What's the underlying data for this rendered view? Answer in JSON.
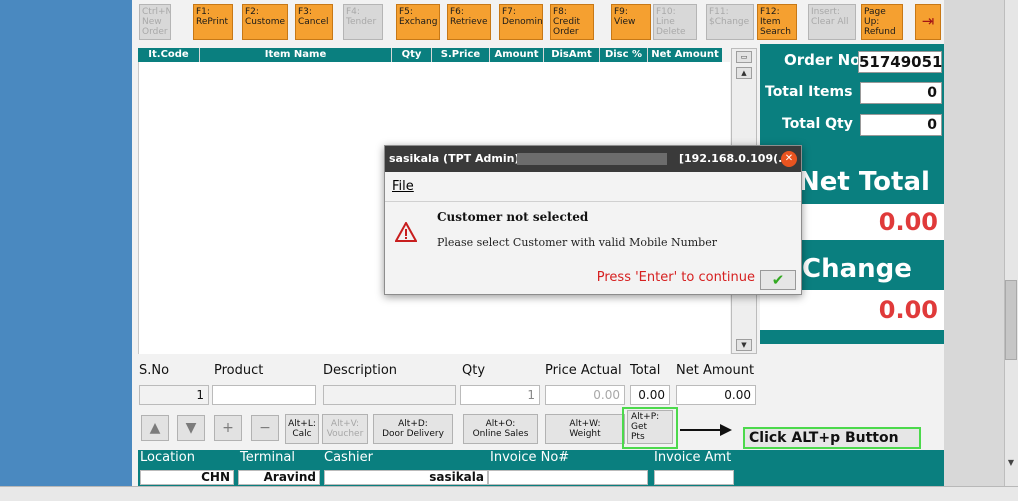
{
  "toolbar": {
    "keys": [
      {
        "l1": "Ctrl+N:",
        "l2": "New",
        "l3": "Order",
        "enabled": false
      },
      {
        "l1": "F1:",
        "l2": "RePrint",
        "l3": "",
        "enabled": true
      },
      {
        "l1": "F2:",
        "l2": "Custome",
        "l3": "",
        "enabled": true
      },
      {
        "l1": "F3:",
        "l2": "Cancel",
        "l3": "",
        "enabled": true
      },
      {
        "l1": "F4:",
        "l2": "Tender",
        "l3": "",
        "enabled": false
      },
      {
        "l1": "F5:",
        "l2": "Exchang",
        "l3": "",
        "enabled": true
      },
      {
        "l1": "F6:",
        "l2": "Retrieve",
        "l3": "",
        "enabled": true
      },
      {
        "l1": "F7:",
        "l2": "Denomin",
        "l3": "",
        "enabled": true
      },
      {
        "l1": "F8:",
        "l2": "Credit",
        "l3": "Order",
        "enabled": true
      },
      {
        "l1": "F9:",
        "l2": "View",
        "l3": "",
        "enabled": true
      },
      {
        "l1": "F10:",
        "l2": "Line",
        "l3": "Delete",
        "enabled": false
      },
      {
        "l1": "F11:",
        "l2": "$Change",
        "l3": "",
        "enabled": false
      },
      {
        "l1": "F12:",
        "l2": "Item",
        "l3": "Search",
        "enabled": true
      },
      {
        "l1": "Insert:",
        "l2": "Clear All",
        "l3": "",
        "enabled": false
      },
      {
        "l1": "Page",
        "l2": "Up:",
        "l3": "Refund",
        "enabled": true
      }
    ]
  },
  "grid": {
    "columns": [
      "It.Code",
      "Item Name",
      "Qty",
      "S.Price",
      "Amount",
      "DisAmt",
      "Disc %",
      "Net Amount"
    ]
  },
  "summary": {
    "order_no_label": "Order No",
    "order_no": "51749051",
    "total_items_label": "Total Items",
    "total_items": "0",
    "total_qty_label": "Total Qty",
    "total_qty": "0",
    "net_total_label": "Net Total",
    "net_total": "0.00",
    "change_label": "Change",
    "change": "0.00"
  },
  "entry": {
    "sno_label": "S.No",
    "sno": "1",
    "product_label": "Product",
    "product": "",
    "description_label": "Description",
    "description": "",
    "qty_label": "Qty",
    "qty": "1",
    "price_actual_label": "Price Actual",
    "price_actual": "0.00",
    "total_label": "Total",
    "total": "0.00",
    "net_amount_label": "Net Amount",
    "net_amount": "0.00"
  },
  "buttons": {
    "calc": {
      "l1": "Alt+L:",
      "l2": "Calc"
    },
    "voucher": {
      "l1": "Alt+V:",
      "l2": "Voucher"
    },
    "door": {
      "l1": "Alt+D:",
      "l2": "Door Delivery"
    },
    "online": {
      "l1": "Alt+O:",
      "l2": "Online Sales"
    },
    "weight": {
      "l1": "Alt+W:",
      "l2": "Weight"
    },
    "getpts": {
      "l1": "Alt+P:",
      "l2": "Get",
      "l3": "Pts"
    }
  },
  "footer": {
    "location_label": "Location",
    "location": "CHN",
    "terminal_label": "Terminal",
    "terminal": "Aravind",
    "cashier_label": "Cashier",
    "cashier": "sasikala",
    "invoice_no_label": "Invoice No#",
    "invoice_no": "",
    "invoice_amt_label": "Invoice Amt",
    "invoice_amt": ""
  },
  "annotation": {
    "text": "Click ALT+p Button"
  },
  "dialog": {
    "title_left": "sasikala (TPT Admin) @",
    "title_right": "[192.168.0.109(...",
    "menu_file": "File",
    "heading": "Customer not selected",
    "message": "Please select Customer with valid Mobile Number",
    "prompt": "Press 'Enter' to continue"
  },
  "colors": {
    "teal": "#0a7f7f",
    "orange": "#f5a030",
    "red": "#e03a3a",
    "green": "#4cd94c"
  }
}
